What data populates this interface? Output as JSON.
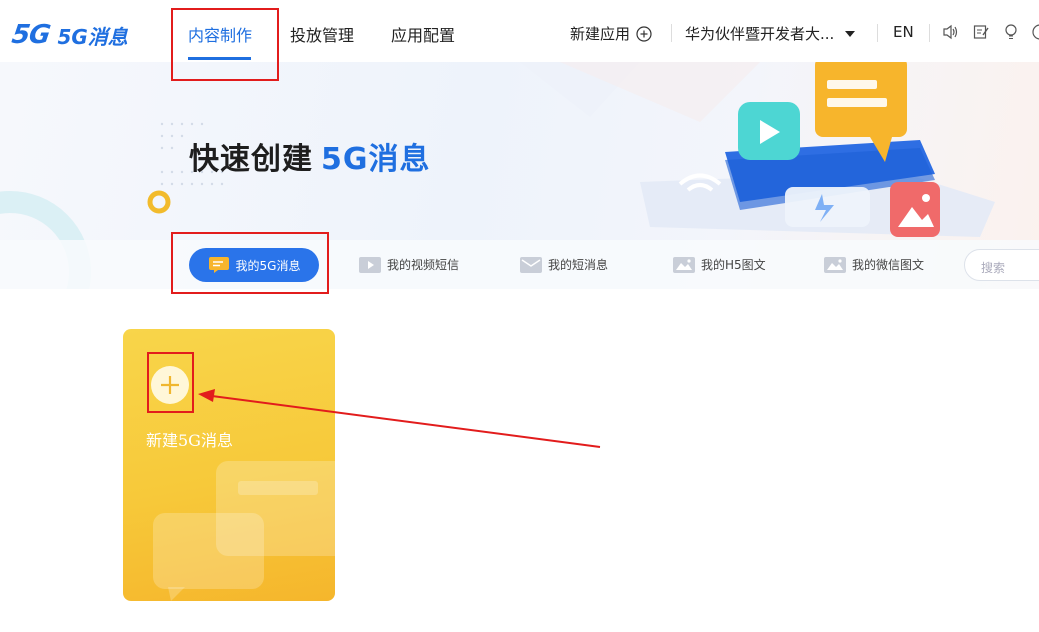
{
  "app": {
    "logo_mark": "5G",
    "logo_text": "5G消息"
  },
  "nav": {
    "tabs": [
      {
        "label": "内容制作",
        "active": true
      },
      {
        "label": "投放管理"
      },
      {
        "label": "应用配置"
      }
    ],
    "new_app_label": "新建应用",
    "account_label": "华为伙伴暨开发者大...",
    "lang_label": "EN"
  },
  "banner": {
    "title_main": "快速创建",
    "title_accent": "5G消息"
  },
  "subnav": {
    "items": [
      {
        "label": "我的5G消息",
        "active": true
      },
      {
        "label": "我的视频短信"
      },
      {
        "label": "我的短消息"
      },
      {
        "label": "我的H5图文"
      },
      {
        "label": "我的微信图文"
      }
    ],
    "search_placeholder": "搜索"
  },
  "card": {
    "label": "新建5G消息"
  },
  "colors": {
    "accent": "#1f6fe0",
    "annotation": "#e21c1c",
    "card": "#f7c93a"
  }
}
